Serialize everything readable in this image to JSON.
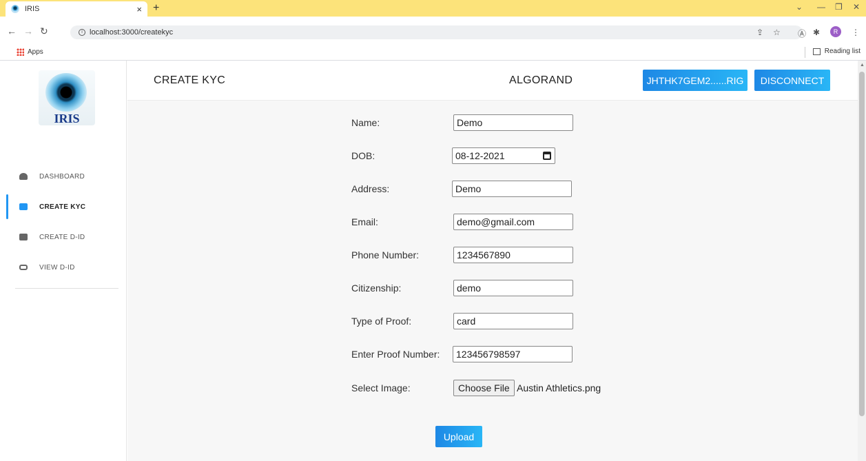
{
  "browser": {
    "tab_title": "IRIS",
    "tab_close": "×",
    "new_tab": "+",
    "url": "localhost:3000/createkyc",
    "bookmarks_apps": "Apps",
    "reading_list": "Reading list",
    "profile_initial": "R"
  },
  "sidebar": {
    "logo_text": "IRIS",
    "items": [
      {
        "label": "DASHBOARD"
      },
      {
        "label": "CREATE KYC"
      },
      {
        "label": "CREATE D-ID"
      },
      {
        "label": "VIEW D-ID"
      }
    ],
    "active_color": "#2196f3"
  },
  "header": {
    "title": "CREATE KYC",
    "network": "ALGORAND",
    "wallet_label": "JHTHK7GEM2......RIG",
    "disconnect_label": "DISCONNECT"
  },
  "form": {
    "name_label": "Name:",
    "name_value": "Demo",
    "dob_label": "DOB:",
    "dob_value": "08-12-2021",
    "address_label": "Address:",
    "address_value": "Demo",
    "email_label": "Email:",
    "email_value": "demo@gmail.com",
    "phone_label": "Phone Number:",
    "phone_value": "1234567890",
    "citizenship_label": "Citizenship:",
    "citizenship_value": "demo",
    "proof_type_label": "Type of Proof:",
    "proof_type_value": "card",
    "proof_number_label": "Enter Proof Number:",
    "proof_number_value": "123456798597",
    "image_label": "Select Image:",
    "choose_file_label": "Choose File",
    "file_name": "Austin Athletics.png",
    "upload_label": "Upload"
  }
}
